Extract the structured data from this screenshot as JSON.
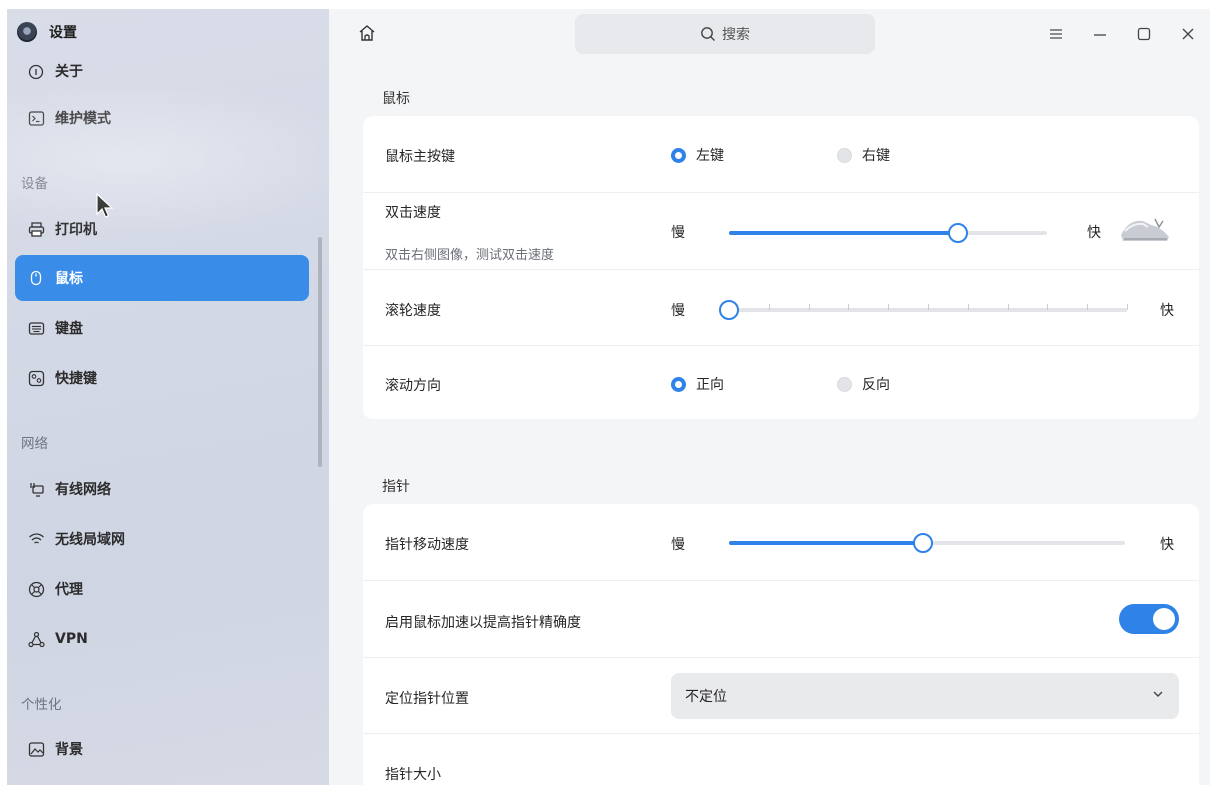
{
  "app": {
    "title": "设置"
  },
  "sidebar": {
    "partial_item": "关于",
    "items": [
      {
        "label": "维护模式",
        "icon": "terminal-icon"
      },
      {
        "label": "打印机",
        "icon": "printer-icon"
      },
      {
        "label": "鼠标",
        "icon": "mouse-icon",
        "active": true
      },
      {
        "label": "键盘",
        "icon": "keyboard-icon"
      },
      {
        "label": "快捷键",
        "icon": "shortcut-icon"
      },
      {
        "label": "有线网络",
        "icon": "wired-network-icon"
      },
      {
        "label": "无线局域网",
        "icon": "wifi-icon"
      },
      {
        "label": "代理",
        "icon": "proxy-icon"
      },
      {
        "label": "VPN",
        "icon": "vpn-icon"
      },
      {
        "label": "背景",
        "icon": "image-icon"
      }
    ],
    "groups": {
      "device": "设备",
      "network": "网络",
      "personalize": "个性化"
    }
  },
  "titlebar": {
    "search_placeholder": "搜索"
  },
  "mouse_section": {
    "title": "鼠标",
    "primary_button": {
      "label": "鼠标主按键",
      "left": "左键",
      "right": "右键",
      "selected": "左键"
    },
    "double_click": {
      "label": "双击速度",
      "hint": "双击右侧图像，测试双击速度",
      "slow": "慢",
      "fast": "快",
      "level": 0.72
    },
    "scroll_speed": {
      "label": "滚轮速度",
      "slow": "慢",
      "fast": "快",
      "level": 0.0,
      "ticks": 10
    },
    "scroll_direction": {
      "label": "滚动方向",
      "forward": "正向",
      "reverse": "反向",
      "selected": "正向"
    }
  },
  "pointer_section": {
    "title": "指针",
    "speed": {
      "label": "指针移动速度",
      "slow": "慢",
      "fast": "快",
      "level": 0.49
    },
    "acceleration": {
      "label": "启用鼠标加速以提高指针精确度",
      "enabled": true
    },
    "locate": {
      "label": "定位指针位置",
      "value": "不定位"
    },
    "size": {
      "label": "指针大小"
    }
  },
  "colors": {
    "accent": "#2f83e8",
    "sidebar_active": "#3a8ce9"
  }
}
